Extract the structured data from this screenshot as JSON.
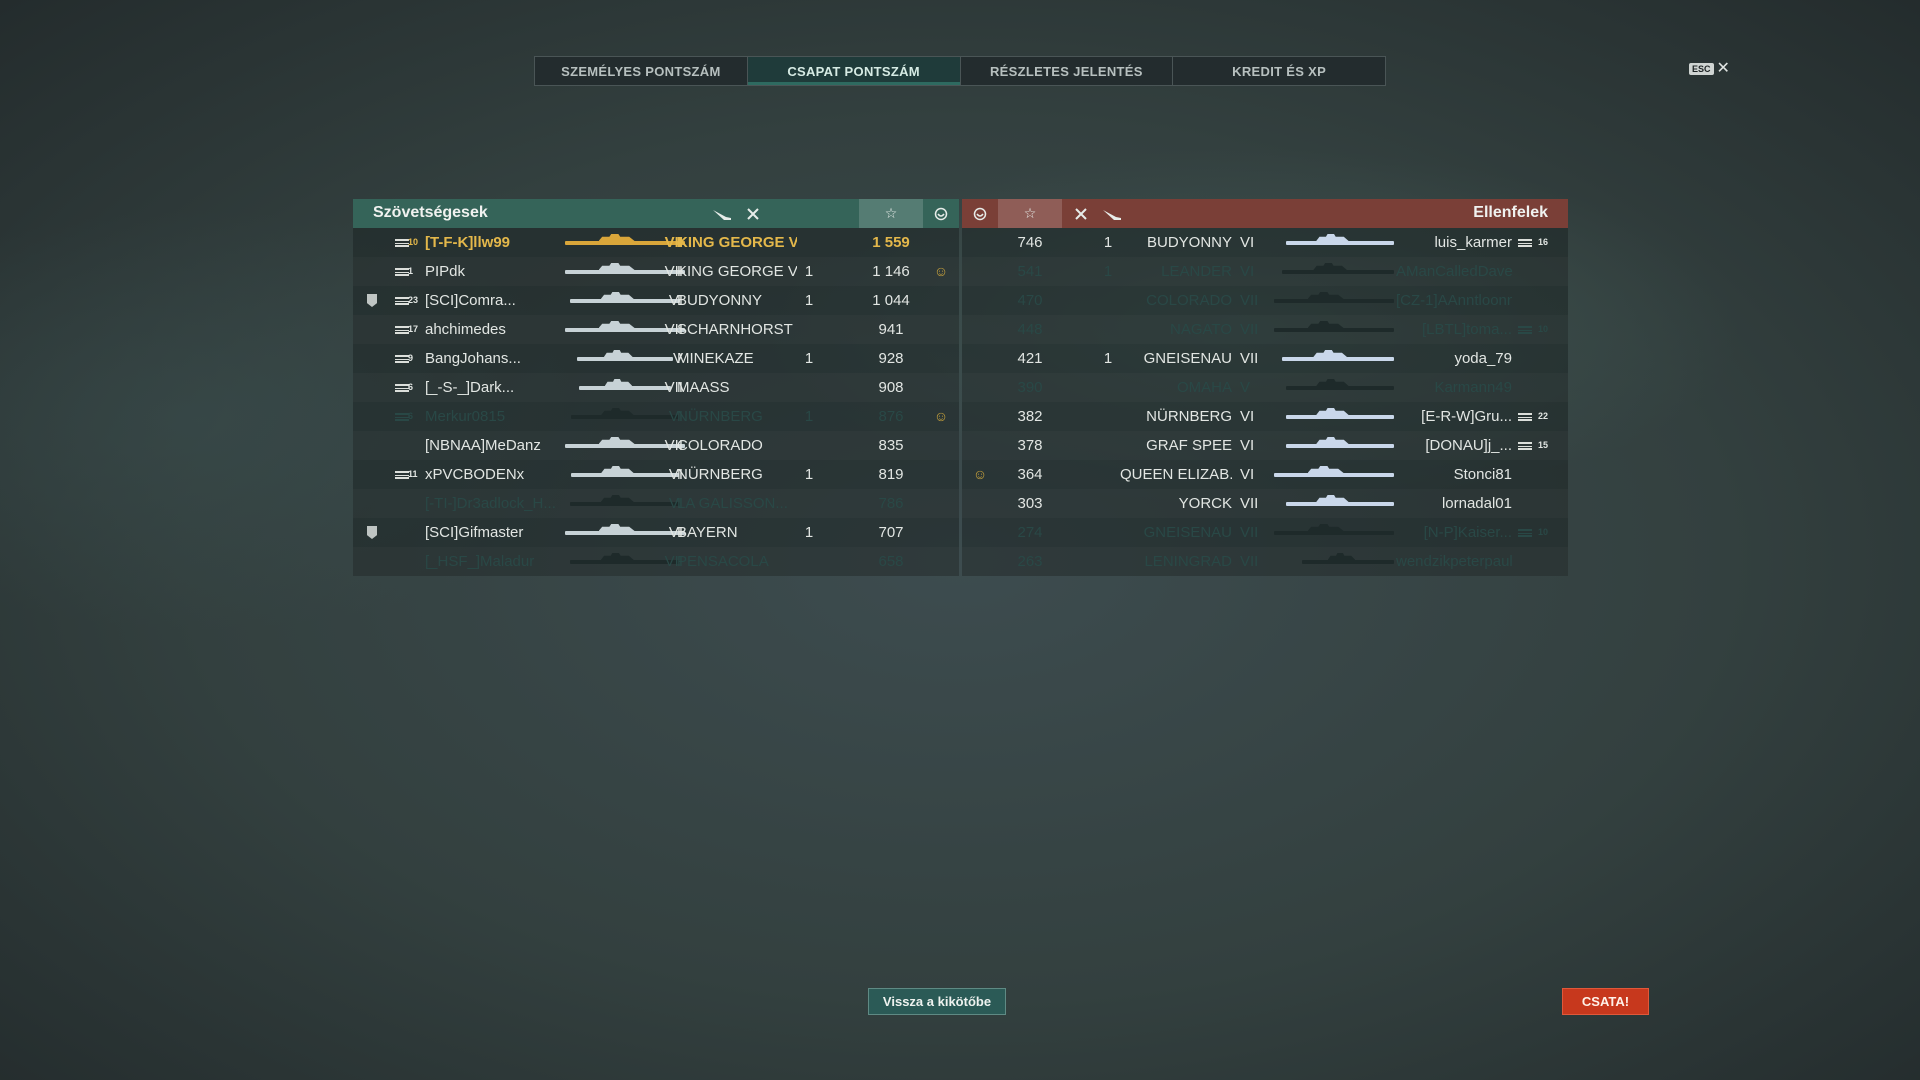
{
  "tabs": [
    {
      "label": "SZEMÉLYES PONTSZÁM",
      "active": false
    },
    {
      "label": "CSAPAT PONTSZÁM",
      "active": true
    },
    {
      "label": "RÉSZLETES JELENTÉS",
      "active": false
    },
    {
      "label": "KREDIT ÉS XP",
      "active": false
    }
  ],
  "esc": {
    "key_label": "ESC",
    "close_glyph": "✕"
  },
  "allies": {
    "title": "Szövetségesek",
    "header_icons": [
      "plane-icon",
      "crossed-swords-icon",
      "star-icon",
      "detected-icon"
    ],
    "rows": [
      {
        "rank": "10",
        "player": "[T-F-K]llw99",
        "tier": "VII",
        "ship": "KING GEORGE V",
        "kills": "",
        "xp": "1 559",
        "detected": false,
        "state": "me",
        "clan_badge": false
      },
      {
        "rank": "1",
        "player": "PIPdk",
        "tier": "VII",
        "ship": "KING GEORGE V",
        "kills": "1",
        "xp": "1 146",
        "detected": true,
        "state": "alive",
        "clan_badge": false
      },
      {
        "rank": "23",
        "player": "[SCI]Comra...",
        "tier": "VI",
        "ship": "BUDYONNY",
        "kills": "1",
        "xp": "1 044",
        "detected": false,
        "state": "alive",
        "clan_badge": true
      },
      {
        "rank": "17",
        "player": "ahchimedes",
        "tier": "VII",
        "ship": "SCHARNHORST",
        "kills": "",
        "xp": "941",
        "detected": false,
        "state": "alive",
        "clan_badge": false
      },
      {
        "rank": "9",
        "player": "BangJohans...",
        "tier": "V",
        "ship": "MINEKAZE",
        "kills": "1",
        "xp": "928",
        "detected": false,
        "state": "alive",
        "clan_badge": false
      },
      {
        "rank": "6",
        "player": "[_-S-_]Dark...",
        "tier": "VII",
        "ship": "MAASS",
        "kills": "",
        "xp": "908",
        "detected": false,
        "state": "alive",
        "clan_badge": false
      },
      {
        "rank": "6",
        "player": "Merkur0815",
        "tier": "VI",
        "ship": "NÜRNBERG",
        "kills": "1",
        "xp": "876",
        "detected": true,
        "state": "dead",
        "clan_badge": false
      },
      {
        "rank": "",
        "player": "[NBNAA]MeDanz",
        "tier": "VII",
        "ship": "COLORADO",
        "kills": "",
        "xp": "835",
        "detected": false,
        "state": "alive",
        "clan_badge": false
      },
      {
        "rank": "11",
        "player": "xPVCBODENx",
        "tier": "VI",
        "ship": "NÜRNBERG",
        "kills": "1",
        "xp": "819",
        "detected": false,
        "state": "alive",
        "clan_badge": false
      },
      {
        "rank": "",
        "player": "[-TI-]Dr3adlock_H...",
        "tier": "VI",
        "ship": "LA GALISSON...",
        "kills": "",
        "xp": "786",
        "detected": false,
        "state": "dead",
        "clan_badge": false
      },
      {
        "rank": "",
        "player": "[SCI]Gifmaster",
        "tier": "VI",
        "ship": "BAYERN",
        "kills": "1",
        "xp": "707",
        "detected": false,
        "state": "alive",
        "clan_badge": true
      },
      {
        "rank": "",
        "player": "[_HSF_]Maladur",
        "tier": "VII",
        "ship": "PENSACOLA",
        "kills": "",
        "xp": "658",
        "detected": false,
        "state": "dead",
        "clan_badge": false
      }
    ]
  },
  "enemies": {
    "title": "Ellenfelek",
    "header_icons": [
      "detected-icon",
      "star-icon",
      "crossed-swords-icon",
      "plane-icon"
    ],
    "rows": [
      {
        "xp": "746",
        "kills": "1",
        "ship": "BUDYONNY",
        "tier": "VI",
        "player": "luis_karmer",
        "rank": "16",
        "detected": false,
        "state": "alive"
      },
      {
        "xp": "541",
        "kills": "1",
        "ship": "LEANDER",
        "tier": "VI",
        "player": "AManCalledDave",
        "rank": "",
        "detected": false,
        "state": "dead"
      },
      {
        "xp": "470",
        "kills": "",
        "ship": "COLORADO",
        "tier": "VII",
        "player": "[CZ-1]AAnntloonn",
        "rank": "",
        "detected": false,
        "state": "dead"
      },
      {
        "xp": "448",
        "kills": "",
        "ship": "NAGATO",
        "tier": "VII",
        "player": "[LBTL]toma...",
        "rank": "10",
        "detected": false,
        "state": "dead"
      },
      {
        "xp": "421",
        "kills": "1",
        "ship": "GNEISENAU",
        "tier": "VII",
        "player": "yoda_79",
        "rank": "",
        "detected": false,
        "state": "alive"
      },
      {
        "xp": "390",
        "kills": "",
        "ship": "OMAHA",
        "tier": "V",
        "player": "Karmann49",
        "rank": "",
        "detected": false,
        "state": "dead"
      },
      {
        "xp": "382",
        "kills": "",
        "ship": "NÜRNBERG",
        "tier": "VI",
        "player": "[E-R-W]Gru...",
        "rank": "22",
        "detected": false,
        "state": "alive"
      },
      {
        "xp": "378",
        "kills": "",
        "ship": "GRAF SPEE",
        "tier": "VI",
        "player": "[DONAU]j_...",
        "rank": "15",
        "detected": false,
        "state": "alive"
      },
      {
        "xp": "364",
        "kills": "",
        "ship": "QUEEN ELIZAB...",
        "tier": "VI",
        "player": "Stonci81",
        "rank": "",
        "detected": true,
        "state": "alive"
      },
      {
        "xp": "303",
        "kills": "",
        "ship": "YORCK",
        "tier": "VII",
        "player": "lornadal01",
        "rank": "",
        "detected": false,
        "state": "alive"
      },
      {
        "xp": "274",
        "kills": "",
        "ship": "GNEISENAU",
        "tier": "VII",
        "player": "[N-P]Kaiser...",
        "rank": "10",
        "detected": false,
        "state": "dead"
      },
      {
        "xp": "263",
        "kills": "",
        "ship": "LENINGRAD",
        "tier": "VII",
        "player": "wendzikpeterpaul",
        "rank": "",
        "detected": false,
        "state": "dead"
      }
    ]
  },
  "buttons": {
    "back": "Vissza a kikötőbe",
    "battle": "CSATA!"
  },
  "colors": {
    "ally_header": "#356459",
    "enemy_header": "#7a3f37",
    "me_highlight": "#e4b84b",
    "dead_text": "#294846",
    "battle_button": "#c7381d"
  }
}
